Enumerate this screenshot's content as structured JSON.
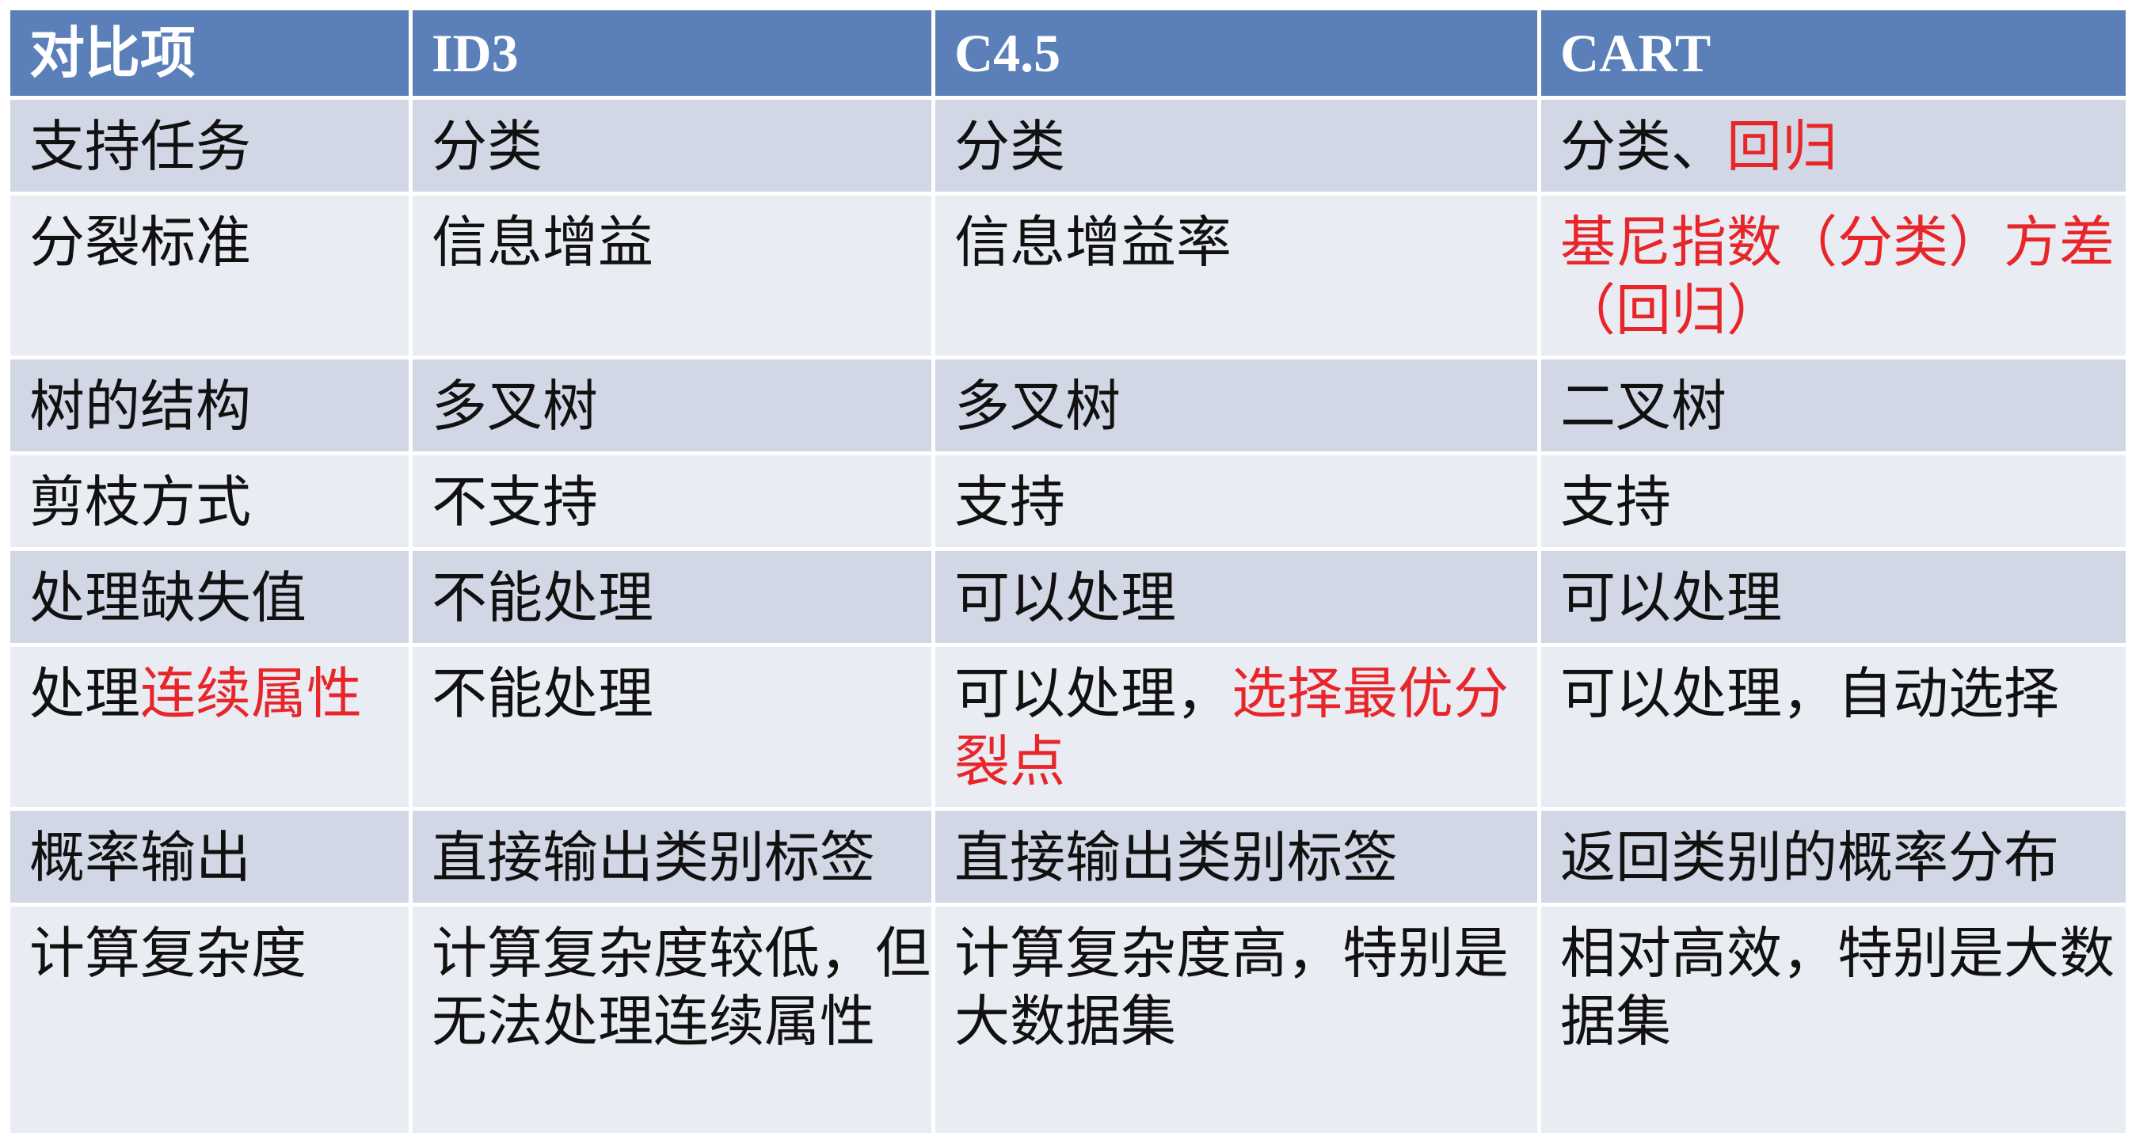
{
  "table": {
    "header": [
      "对比项",
      "ID3",
      "C4.5",
      "CART"
    ],
    "rows": [
      [
        [
          {
            "t": "支持任务"
          }
        ],
        [
          {
            "t": "分类"
          }
        ],
        [
          {
            "t": "分类"
          }
        ],
        [
          {
            "t": "分类、"
          },
          {
            "t": "回归",
            "red": true
          }
        ]
      ],
      [
        [
          {
            "t": "分裂标准"
          }
        ],
        [
          {
            "t": "信息增益"
          }
        ],
        [
          {
            "t": "信息增益率"
          }
        ],
        [
          {
            "t": "基尼指数（分类）方差（回归）",
            "red": true
          }
        ]
      ],
      [
        [
          {
            "t": "树的结构"
          }
        ],
        [
          {
            "t": "多叉树"
          }
        ],
        [
          {
            "t": "多叉树"
          }
        ],
        [
          {
            "t": "二叉树"
          }
        ]
      ],
      [
        [
          {
            "t": "剪枝方式"
          }
        ],
        [
          {
            "t": "不支持"
          }
        ],
        [
          {
            "t": "支持"
          }
        ],
        [
          {
            "t": "支持"
          }
        ]
      ],
      [
        [
          {
            "t": "处理缺失值"
          }
        ],
        [
          {
            "t": "不能处理"
          }
        ],
        [
          {
            "t": "可以处理"
          }
        ],
        [
          {
            "t": "可以处理"
          }
        ]
      ],
      [
        [
          {
            "t": "处理"
          },
          {
            "t": "连续属性",
            "red": true
          }
        ],
        [
          {
            "t": "不能处理"
          }
        ],
        [
          {
            "t": "可以处理，"
          },
          {
            "t": "选择最优分裂点",
            "red": true
          }
        ],
        [
          {
            "t": "可以处理，自动选择"
          }
        ]
      ],
      [
        [
          {
            "t": "概率输出"
          }
        ],
        [
          {
            "t": "直接输出类别标签"
          }
        ],
        [
          {
            "t": "直接输出类别标签"
          }
        ],
        [
          {
            "t": "返回类别的概率分布"
          }
        ]
      ],
      [
        [
          {
            "t": "计算复杂度"
          }
        ],
        [
          {
            "t": "计算复杂度较低，但无法处理连续属性"
          }
        ],
        [
          {
            "t": "计算复杂度高，特别是大数据集"
          }
        ],
        [
          {
            "t": "相对高效，特别是大数据集"
          }
        ]
      ]
    ],
    "colors": {
      "header_bg": "#5b7fb9",
      "row_odd_bg": "#d1d7e5",
      "row_even_bg": "#e9ecf3",
      "highlight_text": "#e8262a"
    }
  }
}
